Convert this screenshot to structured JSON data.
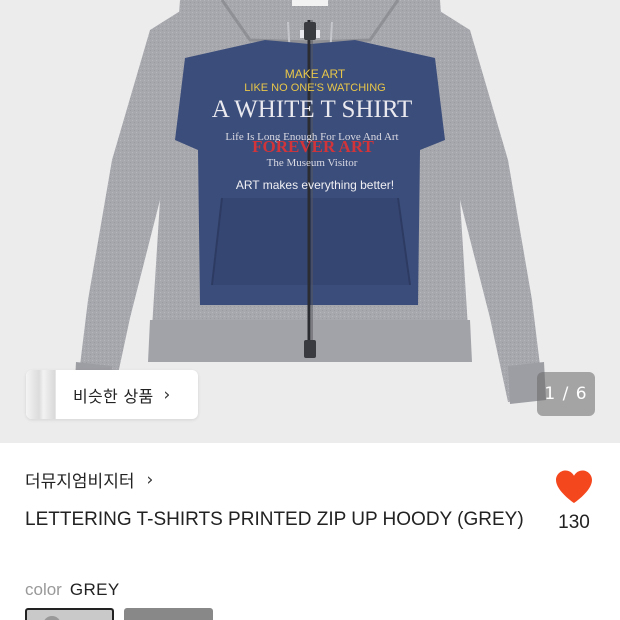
{
  "gallery": {
    "image_texts": {
      "line1": "MAKE ART",
      "line2": "LIKE NO ONE'S WATCHING",
      "line3": "A WHITE T SHIRT",
      "line4": "Life Is Long Enough For Love And Art",
      "line5": "FOREVER ART",
      "line6": "The Museum Visitor",
      "line7": "ART makes everything better!"
    },
    "similar_products_label": "비슷한 상품",
    "counter": "1 / 6"
  },
  "product": {
    "brand": "더뮤지엄비지터",
    "title": "LETTERING T-SHIRTS PRINTED ZIP UP HOODY (GREY)",
    "like_count": "130",
    "option_key": "color",
    "option_value": "GREY"
  },
  "colors": {
    "heart": "#f5471e",
    "background_gallery": "#ececec",
    "hoodie_grey": "#a9aab0",
    "print_navy": "#3b4d7a"
  }
}
